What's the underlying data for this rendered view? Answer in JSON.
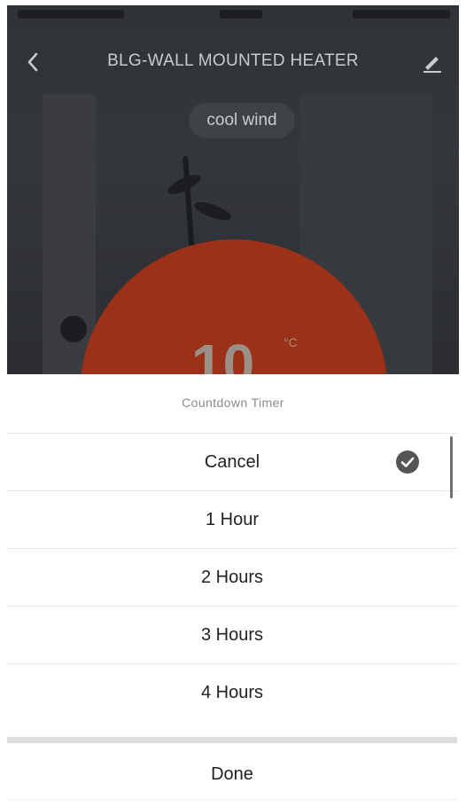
{
  "header": {
    "title": "BLG-WALL MOUNTED HEATER",
    "back_icon": "chevron-left-icon",
    "edit_icon": "pencil-icon"
  },
  "mode": {
    "label": "cool wind"
  },
  "temperature": {
    "value": "10",
    "unit": "°C"
  },
  "colors": {
    "accent": "#9a3118",
    "overlay": "#2f3237",
    "check": "#555555"
  },
  "sheet": {
    "title": "Countdown Timer",
    "options": [
      {
        "label": "Cancel",
        "selected": true
      },
      {
        "label": "1 Hour",
        "selected": false
      },
      {
        "label": "2 Hours",
        "selected": false
      },
      {
        "label": "3 Hours",
        "selected": false
      },
      {
        "label": "4 Hours",
        "selected": false
      }
    ],
    "done_label": "Done"
  }
}
